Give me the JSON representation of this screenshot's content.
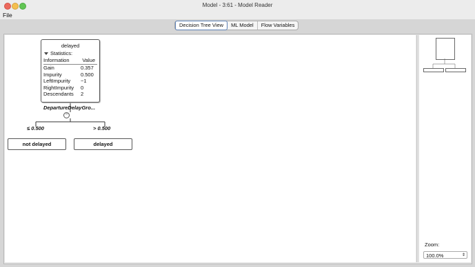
{
  "window": {
    "title": "Model - 3:61 - Model Reader"
  },
  "menu": {
    "file": "File"
  },
  "tabs": [
    {
      "label": "Decision Tree View",
      "active": true
    },
    {
      "label": "ML Model",
      "active": false
    },
    {
      "label": "Flow Variables",
      "active": false
    }
  ],
  "root_node": {
    "title": "delayed",
    "statistics_label": "Statistics:",
    "columns": {
      "info": "Information",
      "value": "Value"
    },
    "rows": [
      {
        "key": "Gain",
        "value": "0.357"
      },
      {
        "key": "Impurity",
        "value": "0.500"
      },
      {
        "key": "LeftImpurity",
        "value": "−1"
      },
      {
        "key": "RightImpurity",
        "value": "0"
      },
      {
        "key": "Descendants",
        "value": "2"
      }
    ]
  },
  "split_attribute": "DepartureDelayGro...",
  "branches": [
    {
      "condition": "≤ 0.500",
      "leaf": "not delayed"
    },
    {
      "condition": "> 0.500",
      "leaf": "delayed"
    }
  ],
  "zoom": {
    "label": "Zoom:",
    "value": "100.0%"
  }
}
